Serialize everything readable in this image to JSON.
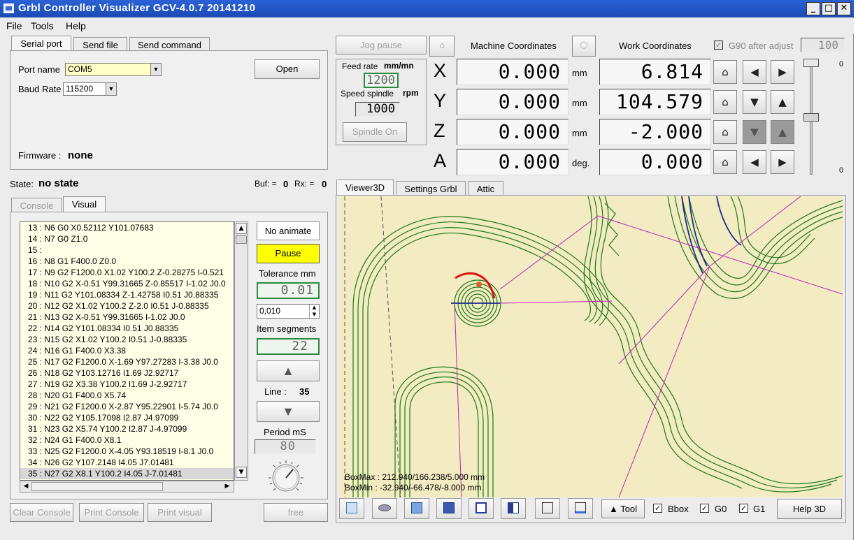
{
  "window": {
    "title": "Grbl Controller Visualizer  GCV-4.0.7  20141210",
    "min_label": "_",
    "max_label": "□",
    "close_label": "✕"
  },
  "menu": {
    "file": "File",
    "tools": "Tools",
    "help": "Help"
  },
  "tabs": {
    "serial_port": "Serial port",
    "send_file": "Send file",
    "send_command": "Send command"
  },
  "serial": {
    "port_name_label": "Port name",
    "port_name_value": "COM5",
    "baud_rate_label": "Baud Rate",
    "baud_rate_value": "115200",
    "open_label": "Open",
    "firmware_label": "Firmware :",
    "firmware_value": "none"
  },
  "status": {
    "state_label": "State:",
    "state_value": "no state",
    "buf_label": "Buf: =",
    "buf_value": "0",
    "rx_label": "Rx: =",
    "rx_value": "0"
  },
  "console_tabs": {
    "console": "Console",
    "visual": "Visual"
  },
  "code_lines": [
    "13 : N6 G0 X0.52112 Y101.07683",
    "14 : N7 G0 Z1.0",
    "15 :",
    "16 : N8 G1 F400.0 Z0.0",
    "17 : N9 G2 F1200.0 X1.02 Y100.2 Z-0.28275 I-0.521",
    "18 : N10 G2 X-0.51 Y99.31665 Z-0.85517 I-1.02 J0.0",
    "19 : N11 G2 Y101.08334 Z-1.42758 I0.51 J0.88335",
    "20 : N12 G2 X1.02 Y100.2 Z-2.0 I0.51 J-0.88335",
    "21 : N13 G2 X-0.51 Y99.31665 I-1.02 J0.0",
    "22 : N14 G2 Y101.08334 I0.51 J0.88335",
    "23 : N15 G2 X1.02 Y100.2 I0.51 J-0.88335",
    "24 : N16 G1 F400.0 X3.38",
    "25 : N17 G2 F1200.0 X-1.69 Y97.27283 I-3.38 J0.0",
    "26 : N18 G2 Y103.12716 I1.69 J2.92717",
    "27 : N19 G2 X3.38 Y100.2 I1.69 J-2.92717",
    "28 : N20 G1 F400.0 X5.74",
    "29 : N21 G2 F1200.0 X-2.87 Y95.22901 I-5.74 J0.0",
    "30 : N22 G2 Y105.17098 I2.87 J4.97099",
    "31 : N23 G2 X5.74 Y100.2 I2.87 J-4.97099",
    "32 : N24 G1 F400.0 X8.1",
    "33 : N25 G2 F1200.0 X-4.05 Y93.18519 I-8.1 J0.0",
    "34 : N26 G2 Y107.2148 I4.05 J7.01481",
    "35 : N27 G2 X8.1 Y100.2 I4.05 J-7.01481"
  ],
  "visual_controls": {
    "no_animate": "No animate",
    "pause": "Pause",
    "tolerance_label": "Tolerance  mm",
    "tolerance_value": "0.01",
    "tolerance_spin": "0,010",
    "item_segments_label": "Item segments",
    "item_segments_value": "22",
    "line_label": "Line :",
    "line_value": "35",
    "period_label": "Period mS",
    "period_value": "80"
  },
  "bottom_buttons": {
    "clear_console": "Clear Console",
    "print_console": "Print Console",
    "print_visual": "Print visual",
    "free": "free"
  },
  "jog": {
    "jog_pause": "Jog pause",
    "feed_rate_label": "Feed rate",
    "feed_rate_unit": "mm/mn",
    "feed_rate_value": "1200",
    "speed_spindle_label": "Speed spindle",
    "speed_spindle_unit": "rpm",
    "speed_spindle_value": "1000",
    "spindle_on": "Spindle On"
  },
  "coords": {
    "machine_label": "Machine Coordinates",
    "work_label": "Work Coordinates",
    "g90_label": "G90 after adjust",
    "g90_value": "100",
    "axes": [
      {
        "axis": "X",
        "machine": "0.000",
        "unit": "mm",
        "work": "6.814"
      },
      {
        "axis": "Y",
        "machine": "0.000",
        "unit": "mm",
        "work": "104.579"
      },
      {
        "axis": "Z",
        "machine": "0.000",
        "unit": "mm",
        "work": "-2.000"
      },
      {
        "axis": "A",
        "machine": "0.000",
        "unit": "deg.",
        "work": "0.000"
      }
    ],
    "slider_top_label": "0",
    "slider_bottom_label": "0"
  },
  "viewer_tabs": {
    "viewer3d": "Viewer3D",
    "settings": "Settings Grbl",
    "attic": "Attic"
  },
  "viewer": {
    "boxmax": "BoxMax : 212.940/166.238/5.000 mm",
    "boxmin": "BoxMin : -32.940/-66.478/-8.000 mm"
  },
  "viewer_toolbar": {
    "tool_label": "Tool",
    "bbox_label": "Bbox",
    "g0_label": "G0",
    "g1_label": "G1",
    "help3d_label": "Help 3D"
  },
  "colors": {
    "viewer_bg": "#f3ebc1",
    "toolpath": "#1a7a1a",
    "rapid": "#c020c0",
    "current": "#e01010",
    "pause_button": "#ffff00"
  }
}
